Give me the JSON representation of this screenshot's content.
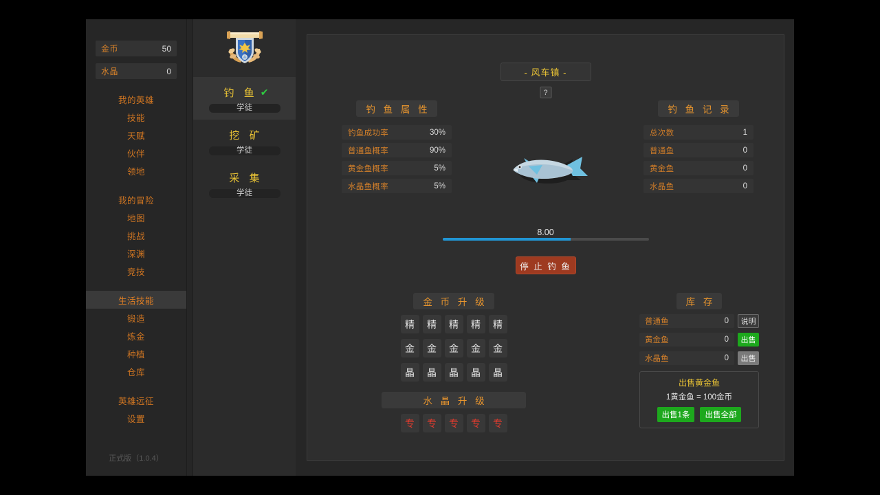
{
  "sidebar": {
    "resources": [
      {
        "name": "金币",
        "value": "50"
      },
      {
        "name": "水晶",
        "value": "0"
      }
    ],
    "groups": [
      {
        "items": [
          "我的英雄",
          "技能",
          "天赋",
          "伙伴",
          "领地"
        ]
      },
      {
        "items": [
          "我的冒险",
          "地图",
          "挑战",
          "深渊",
          "竞技"
        ]
      },
      {
        "items": [
          "生活技能",
          "锻造",
          "炼金",
          "种植",
          "仓库"
        ]
      },
      {
        "items": [
          "英雄远征",
          "设置"
        ]
      }
    ],
    "active_item": "生活技能",
    "version": "正式版（1.0.4）"
  },
  "skills": [
    {
      "title": "钓 鱼",
      "rank": "学徒",
      "selected": true,
      "check": "✔"
    },
    {
      "title": "挖 矿",
      "rank": "学徒",
      "selected": false,
      "check": ""
    },
    {
      "title": "采 集",
      "rank": "学徒",
      "selected": false,
      "check": ""
    }
  ],
  "main": {
    "town": "- 风车镇 -",
    "help_label": "?",
    "attributes": {
      "title": "钓 鱼 属 性",
      "rows": [
        {
          "k": "钓鱼成功率",
          "v": "30%"
        },
        {
          "k": "普通鱼概率",
          "v": "90%"
        },
        {
          "k": "黄金鱼概率",
          "v": "5%"
        },
        {
          "k": "水晶鱼概率",
          "v": "5%"
        }
      ]
    },
    "records": {
      "title": "钓 鱼 记 录",
      "rows": [
        {
          "k": "总次数",
          "v": "1"
        },
        {
          "k": "普通鱼",
          "v": "0"
        },
        {
          "k": "黄金鱼",
          "v": "0"
        },
        {
          "k": "水晶鱼",
          "v": "0"
        }
      ]
    },
    "progress": {
      "label": "8.00",
      "percent": 62
    },
    "stop_button": "停 止 钓 鱼",
    "upgrades": {
      "gold_title": "金 币 升 级",
      "crystal_title": "水 晶 升 级",
      "gold_rows": [
        [
          "精",
          "精",
          "精",
          "精",
          "精"
        ],
        [
          "金",
          "金",
          "金",
          "金",
          "金"
        ],
        [
          "晶",
          "晶",
          "晶",
          "晶",
          "晶"
        ]
      ],
      "crystal_row": [
        "专",
        "专",
        "专",
        "专",
        "专"
      ]
    },
    "inventory": {
      "title": "库 存",
      "rows": [
        {
          "k": "普通鱼",
          "v": "0",
          "btn": "说明",
          "style": "plain"
        },
        {
          "k": "黄金鱼",
          "v": "0",
          "btn": "出售",
          "style": "green"
        },
        {
          "k": "水晶鱼",
          "v": "0",
          "btn": "出售",
          "style": "grey"
        }
      ],
      "sell": {
        "title": "出售黄金鱼",
        "rate": "1黄金鱼 = 100金币",
        "btn_one": "出售1条",
        "btn_all": "出售全部"
      }
    }
  },
  "colors": {
    "accent_orange": "#d4802a",
    "gold": "#e8c235",
    "green": "#1da81d",
    "red": "#9e3a20",
    "progress_blue": "#2196d4"
  }
}
